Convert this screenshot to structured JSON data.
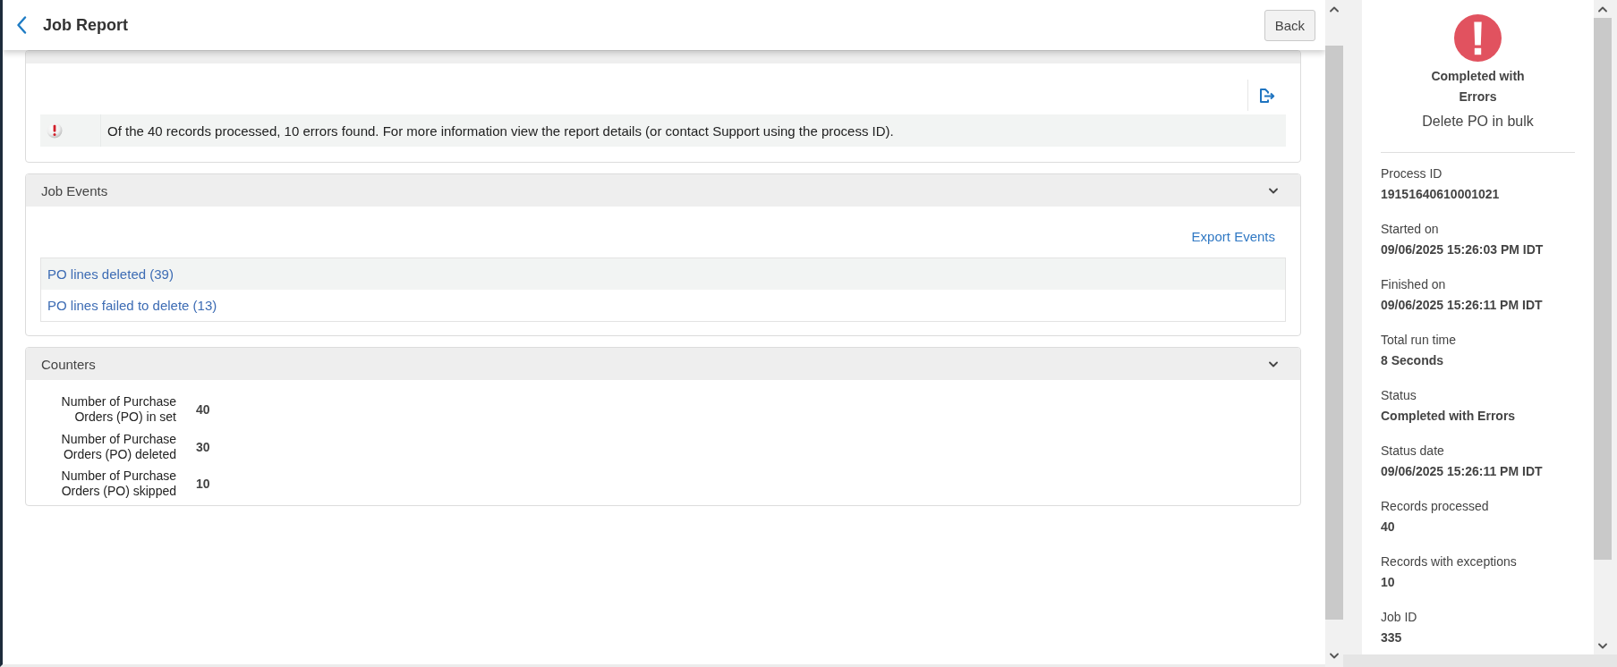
{
  "header": {
    "title": "Job Report",
    "back_button": "Back"
  },
  "alerts": {
    "messages": [
      {
        "kind": "error",
        "text": "Of the 40 records processed, 10 errors found. For more information view the report details (or contact Support using the process ID)."
      }
    ]
  },
  "job_events": {
    "title": "Job Events",
    "expanded": true,
    "export_link": "Export Events",
    "events": [
      {
        "label": "PO lines deleted (39)"
      },
      {
        "label": "PO lines failed to delete (13)"
      }
    ]
  },
  "counters": {
    "title": "Counters",
    "expanded": true,
    "rows": [
      {
        "label": "Number of Purchase Orders (PO) in set",
        "value": "40"
      },
      {
        "label": "Number of Purchase Orders (PO) deleted",
        "value": "30"
      },
      {
        "label": "Number of Purchase Orders (PO) skipped",
        "value": "10"
      }
    ]
  },
  "summary": {
    "kind": "error",
    "status": "Completed with Errors",
    "job_name": "Delete PO in bulk",
    "fields": [
      {
        "label": "Process ID",
        "value": "19151640610001021"
      },
      {
        "label": "Started on",
        "value": "09/06/2025 15:26:03 PM IDT"
      },
      {
        "label": "Finished on",
        "value": "09/06/2025 15:26:11 PM IDT"
      },
      {
        "label": "Total run time",
        "value": "8 Seconds"
      },
      {
        "label": "Status",
        "value": "Completed with Errors"
      },
      {
        "label": "Status date",
        "value": "09/06/2025 15:26:11 PM IDT"
      },
      {
        "label": "Records processed",
        "value": "40"
      },
      {
        "label": "Records with exceptions",
        "value": "10"
      },
      {
        "label": "Job ID",
        "value": "335"
      }
    ]
  }
}
